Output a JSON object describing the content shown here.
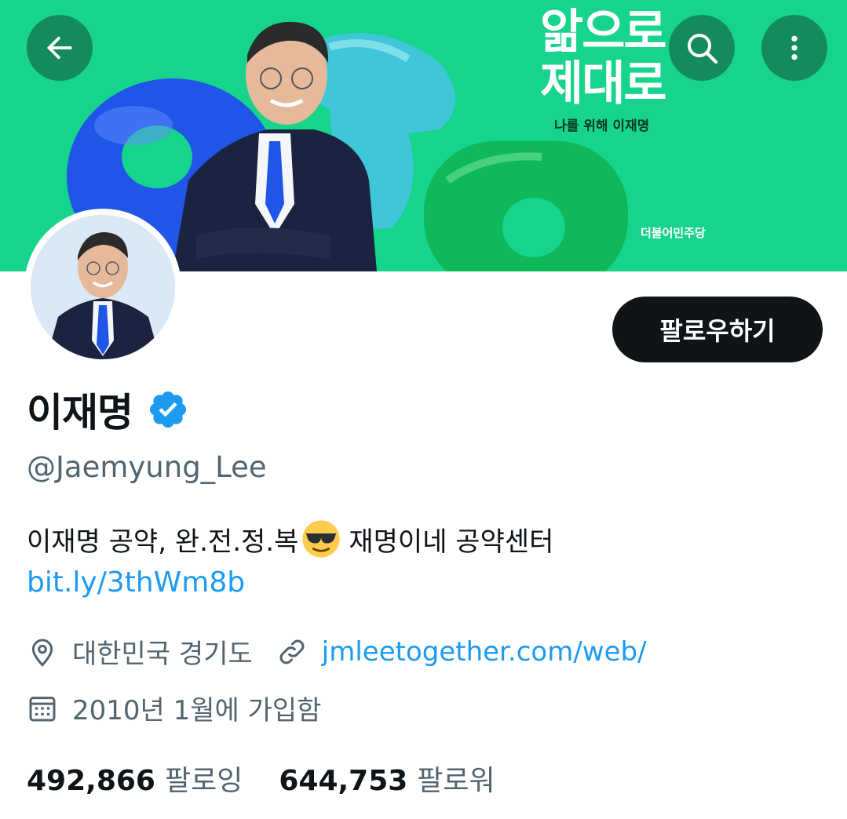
{
  "banner": {
    "title_line1": "앎으로",
    "title_line2": "제대로",
    "subtitle": "나를 위해 이재명",
    "party": "더불어민주당",
    "background_color": "#17d48c"
  },
  "nav": {
    "back_icon": "arrow-left-icon",
    "search_icon": "search-icon",
    "more_icon": "more-vertical-icon"
  },
  "profile": {
    "name": "이재명",
    "handle": "@Jaemyung_Lee",
    "verified_icon": "verified-badge-icon",
    "follow_label": "팔로우하기",
    "bio_part1": "이재명 공약, 완.전.정.복",
    "bio_emoji": "sunglasses-emoji",
    "bio_part2": "재명이네 공약센터",
    "bio_link": "bit.ly/3thWm8b",
    "location": "대한민국 경기도",
    "website": "jmleetogether.com/web/",
    "joined": "2010년 1월에 가입함",
    "following_count": "492,866",
    "following_label": "팔로잉",
    "followers_count": "644,753",
    "followers_label": "팔로워"
  },
  "colors": {
    "accent": "#1d9bf0",
    "text_primary": "#0f1419",
    "text_secondary": "#536471"
  }
}
